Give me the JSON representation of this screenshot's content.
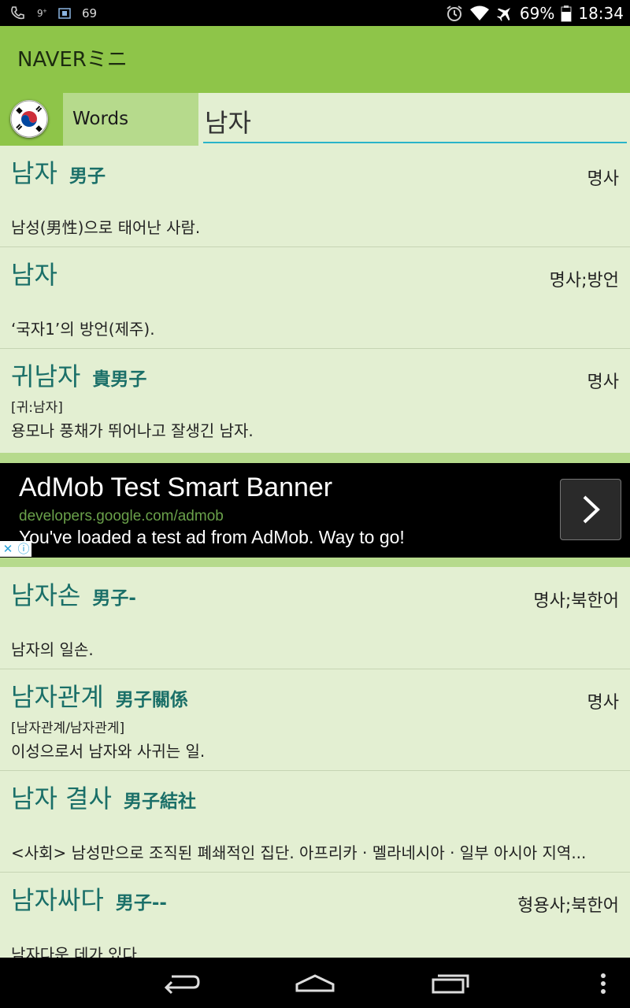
{
  "status_bar": {
    "left_icons": [
      "phone-icon",
      "signal-icon",
      "screenshot-icon"
    ],
    "notif_count": "69",
    "battery": "69%",
    "time": "18:34",
    "right_icons": [
      "alarm-icon",
      "wifi-icon",
      "airplane-icon",
      "battery-icon"
    ]
  },
  "app": {
    "title": "NAVERミニ"
  },
  "search": {
    "mode_label": "Words",
    "query": "남자"
  },
  "entries_top": [
    {
      "word": "남자",
      "hanja": "男子",
      "pos": "명사",
      "pron": "",
      "definition": "남성(男性)으로 태어난 사람."
    },
    {
      "word": "남자",
      "hanja": "",
      "pos": "명사;방언",
      "pron": "",
      "definition": "‘국자1’의 방언(제주)."
    },
    {
      "word": "귀남자",
      "hanja": "貴男子",
      "pos": "명사",
      "pron": "[귀:남자]",
      "definition": "용모나 풍채가 뛰어나고 잘생긴 남자."
    }
  ],
  "ad": {
    "title": "AdMob Test Smart Banner",
    "url": "developers.google.com/admob",
    "body": "You've loaded a test ad from AdMob. Way to go!",
    "close_glyph": "✕",
    "info_glyph": "ⓘ"
  },
  "entries_bottom": [
    {
      "word": "남자손",
      "hanja": "男子-",
      "pos": "명사;북한어",
      "pron": "",
      "definition": "남자의 일손."
    },
    {
      "word": "남자관계",
      "hanja": "男子關係",
      "pos": "명사",
      "pron": "[남자관계/남자관게]",
      "definition": "이성으로서 남자와 사귀는 일."
    },
    {
      "word": "남자 결사",
      "hanja": "男子結社",
      "pos": "",
      "pron": "",
      "definition": "<사회> 남성만으로 조직된 폐쇄적인 집단. 아프리카 · 멜라네시아 · 일부 아시아 지역..."
    },
    {
      "word": "남자싸다",
      "hanja": "男子--",
      "pos": "형용사;북한어",
      "pron": "",
      "definition": "남자다운 데가 있다."
    }
  ],
  "colors": {
    "appbar": "#8ec549",
    "background": "#e3efd2",
    "word": "#1a6f68",
    "input_underline": "#2ab4c9"
  }
}
